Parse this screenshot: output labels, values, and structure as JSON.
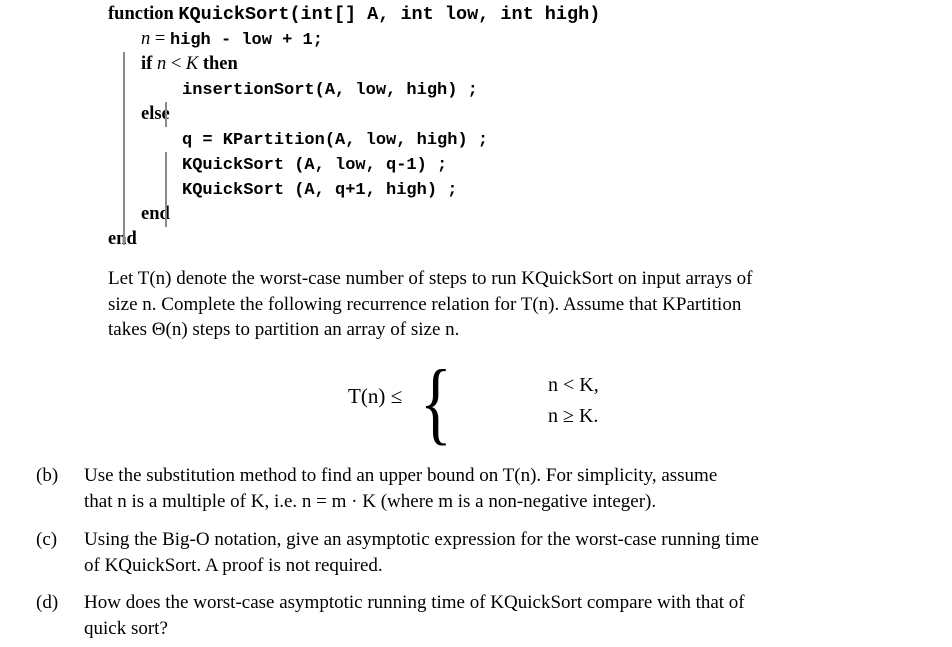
{
  "document": {
    "algorithm": {
      "signature": {
        "keyword": "function",
        "call": "KQuickSort(int[] A, int low, int high)"
      },
      "lines": [
        {
          "id": "assign-n",
          "parts": [
            {
              "type": "mvar",
              "text": "n"
            },
            {
              "type": "serif",
              "text": " = "
            },
            {
              "type": "mono",
              "text": "high - low + 1;"
            }
          ]
        },
        {
          "id": "if-condition",
          "parts": [
            {
              "type": "kw",
              "text": "if "
            },
            {
              "type": "mvar",
              "text": "n"
            },
            {
              "type": "serif",
              "text": " < "
            },
            {
              "type": "mvar",
              "text": "K"
            },
            {
              "type": "kw",
              "text": " then"
            }
          ]
        },
        {
          "id": "insertion-sort-call",
          "parts": [
            {
              "type": "mono",
              "text": "insertionSort(A, low, high) ;"
            }
          ]
        },
        {
          "id": "else-keyword",
          "parts": [
            {
              "type": "kw",
              "text": "else"
            }
          ]
        },
        {
          "id": "partition-call",
          "parts": [
            {
              "type": "mono",
              "text": "q = KPartition(A, low, high) ;"
            }
          ]
        },
        {
          "id": "recursive-call-left",
          "parts": [
            {
              "type": "mono",
              "text": "KQuickSort (A, low, q-1) ;"
            }
          ]
        },
        {
          "id": "recursive-call-right",
          "parts": [
            {
              "type": "mono",
              "text": "KQuickSort (A, q+1, high) ;"
            }
          ]
        },
        {
          "id": "end-inner",
          "parts": [
            {
              "type": "kw",
              "text": "end"
            }
          ]
        },
        {
          "id": "end-outer",
          "parts": [
            {
              "type": "kw",
              "text": "end"
            }
          ]
        }
      ]
    },
    "intro_paragraph": {
      "line1": "Let T(n) denote the worst-case number of steps to run KQuickSort on input arrays of",
      "line2": "size n. Complete the following recurrence relation for T(n). Assume that KPartition",
      "line3": "takes Θ(n) steps to partition an array of size n."
    },
    "equation": {
      "lhs": "T(n) ≤",
      "brace": "{",
      "cases": [
        {
          "condition": "n < K,"
        },
        {
          "condition": "n ≥ K."
        }
      ]
    },
    "items": [
      {
        "label": "(b)",
        "line1": "Use the substitution method to find an upper bound on T(n). For simplicity, assume",
        "line2": "that n is a multiple of K, i.e. n = m · K (where m is a non-negative integer)."
      },
      {
        "label": "(c)",
        "line1": "Using the Big-O notation, give an asymptotic expression for the worst-case running time",
        "line2": "of KQuickSort. A proof is not required."
      },
      {
        "label": "(d)",
        "line1": "How does the worst-case asymptotic running time of KQuickSort compare with that of",
        "line2": "quick sort?"
      }
    ]
  }
}
